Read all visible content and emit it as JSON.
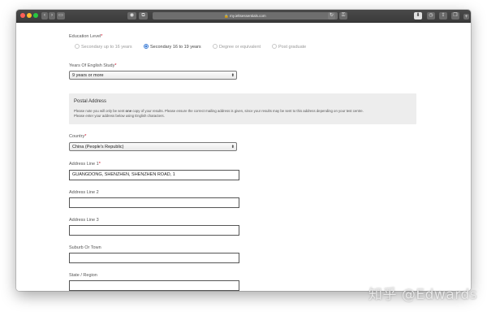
{
  "browser": {
    "url": "my.ieltsessentials.com",
    "lock_icon": "lock-icon"
  },
  "form": {
    "education": {
      "label": "Education Level",
      "required_mark": "*",
      "options": [
        {
          "label": "Secondary up to 16 years",
          "selected": false
        },
        {
          "label": "Secondary 16 to 19 years",
          "selected": true
        },
        {
          "label": "Degree or equivalent",
          "selected": false
        },
        {
          "label": "Post graduate",
          "selected": false
        }
      ]
    },
    "years_english": {
      "label": "Years Of English Study",
      "required_mark": "*",
      "value": "9 years or more"
    },
    "postal": {
      "title": "Postal Address",
      "note_line1_a": "Please note you will only be sent ",
      "note_line1_bold": "one",
      "note_line1_b": " copy of your results. Please ensure the correct mailing address is given, since your results may be sent to this address depending on your test centre.",
      "note_line2": "Please enter your address below using English characters."
    },
    "country": {
      "label": "Country",
      "required_mark": "*",
      "value": "China (People's Republic)"
    },
    "address1": {
      "label": "Address Line 1",
      "required_mark": "*",
      "value": "GUANGDONG, SHENZHEN, SHENZHEN ROAD, 1"
    },
    "address2": {
      "label": "Address Line 2",
      "value": ""
    },
    "address3": {
      "label": "Address Line 3",
      "value": ""
    },
    "suburb": {
      "label": "Suburb Or Town",
      "value": ""
    },
    "state": {
      "label": "State / Region",
      "value": ""
    }
  },
  "watermark": "知乎 @Edwards"
}
